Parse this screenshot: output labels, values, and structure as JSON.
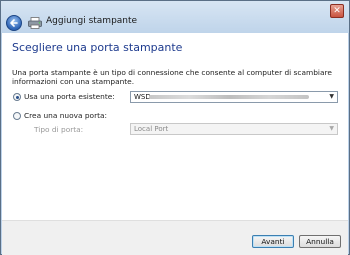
{
  "window": {
    "title": "Aggiungi stampante",
    "close_glyph": "✕"
  },
  "page": {
    "heading": "Scegliere una porta stampante",
    "description": "Una porta stampante è un tipo di connessione che consente al computer di scambiare informazioni con una stampante."
  },
  "options": {
    "existing_port": {
      "label": "Usa una porta esistente:",
      "selected": true,
      "value": "WSD-"
    },
    "new_port": {
      "label": "Crea una nuova porta:",
      "selected": false,
      "type_label": "Tipo di porta:",
      "type_value": "Local Port"
    }
  },
  "buttons": {
    "next": "Avanti",
    "cancel": "Annulla"
  },
  "icons": {
    "back": "back-arrow-icon",
    "printer": "printer-icon",
    "close": "close-icon",
    "dropdown": "chevron-down-icon"
  }
}
